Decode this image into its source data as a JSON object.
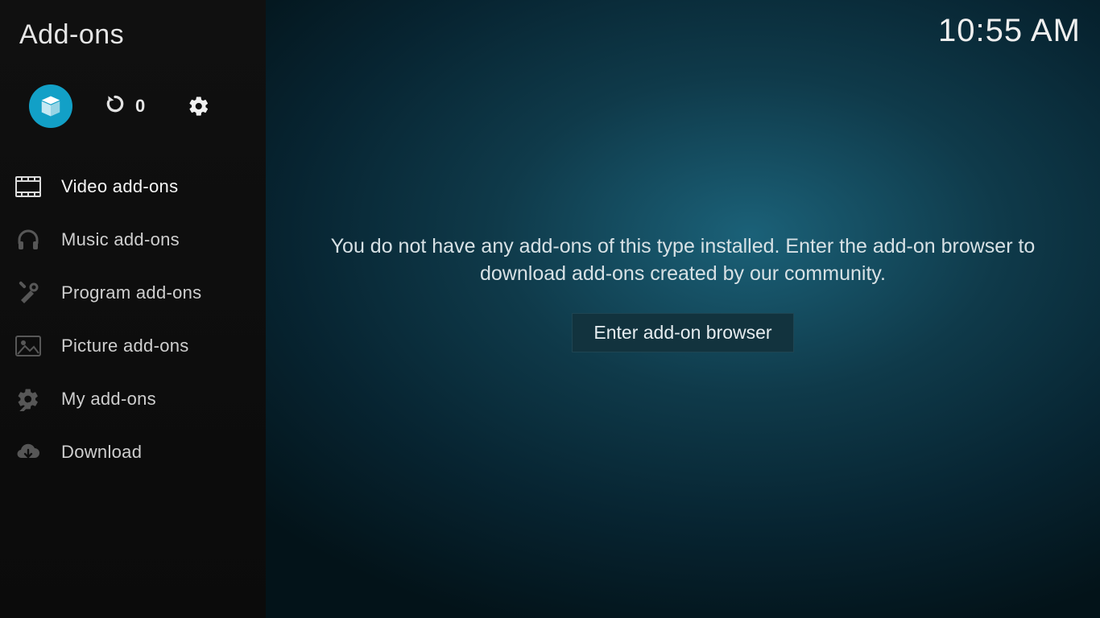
{
  "header": {
    "title": "Add-ons",
    "clock": "10:55 AM"
  },
  "topbar": {
    "update_count": "0"
  },
  "sidebar": {
    "items": [
      {
        "label": "Video add-ons"
      },
      {
        "label": "Music add-ons"
      },
      {
        "label": "Program add-ons"
      },
      {
        "label": "Picture add-ons"
      },
      {
        "label": "My add-ons"
      },
      {
        "label": "Download"
      }
    ]
  },
  "main": {
    "empty_message": "You do not have any add-ons of this type installed. Enter the add-on browser to download add-ons created by our community.",
    "enter_button": "Enter add-on browser"
  }
}
